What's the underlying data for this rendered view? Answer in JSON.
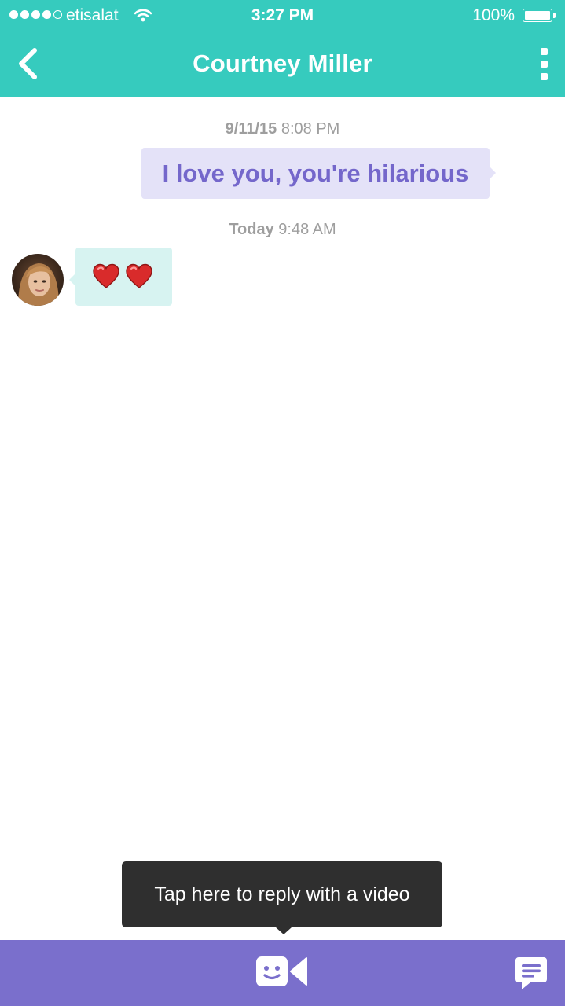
{
  "status_bar": {
    "carrier": "etisalat",
    "signal_bars": 4,
    "signal_total": 5,
    "time": "3:27 PM",
    "battery": "100%",
    "battery_level": 1.0
  },
  "nav": {
    "title": "Courtney Miller",
    "back_icon": "chevron-left-icon",
    "more_icon": "vertical-ellipsis-icon"
  },
  "conversation": {
    "messages": [
      {
        "timestamp_date": "9/11/15",
        "timestamp_time": "8:08 PM",
        "direction": "sent",
        "text": "I love you, you're hilarious"
      },
      {
        "timestamp_date": "Today",
        "timestamp_time": "9:48 AM",
        "direction": "received",
        "content_icons": [
          "heart-emoji",
          "heart-emoji"
        ]
      }
    ]
  },
  "tooltip": {
    "text": "Tap here to reply with a video"
  },
  "bottom_bar": {
    "video_icon": "smiley-video-camera-icon",
    "messages_icon": "chat-bubble-lines-icon"
  },
  "colors": {
    "header": "#36cbbe",
    "sent_bubble": "#e4e2f8",
    "sent_text": "#7467cb",
    "received_bubble": "#d7f3f1",
    "timestamp": "#9e9e9e",
    "tooltip": "#2f2f2f",
    "bottom_bar": "#7a6fcc"
  }
}
